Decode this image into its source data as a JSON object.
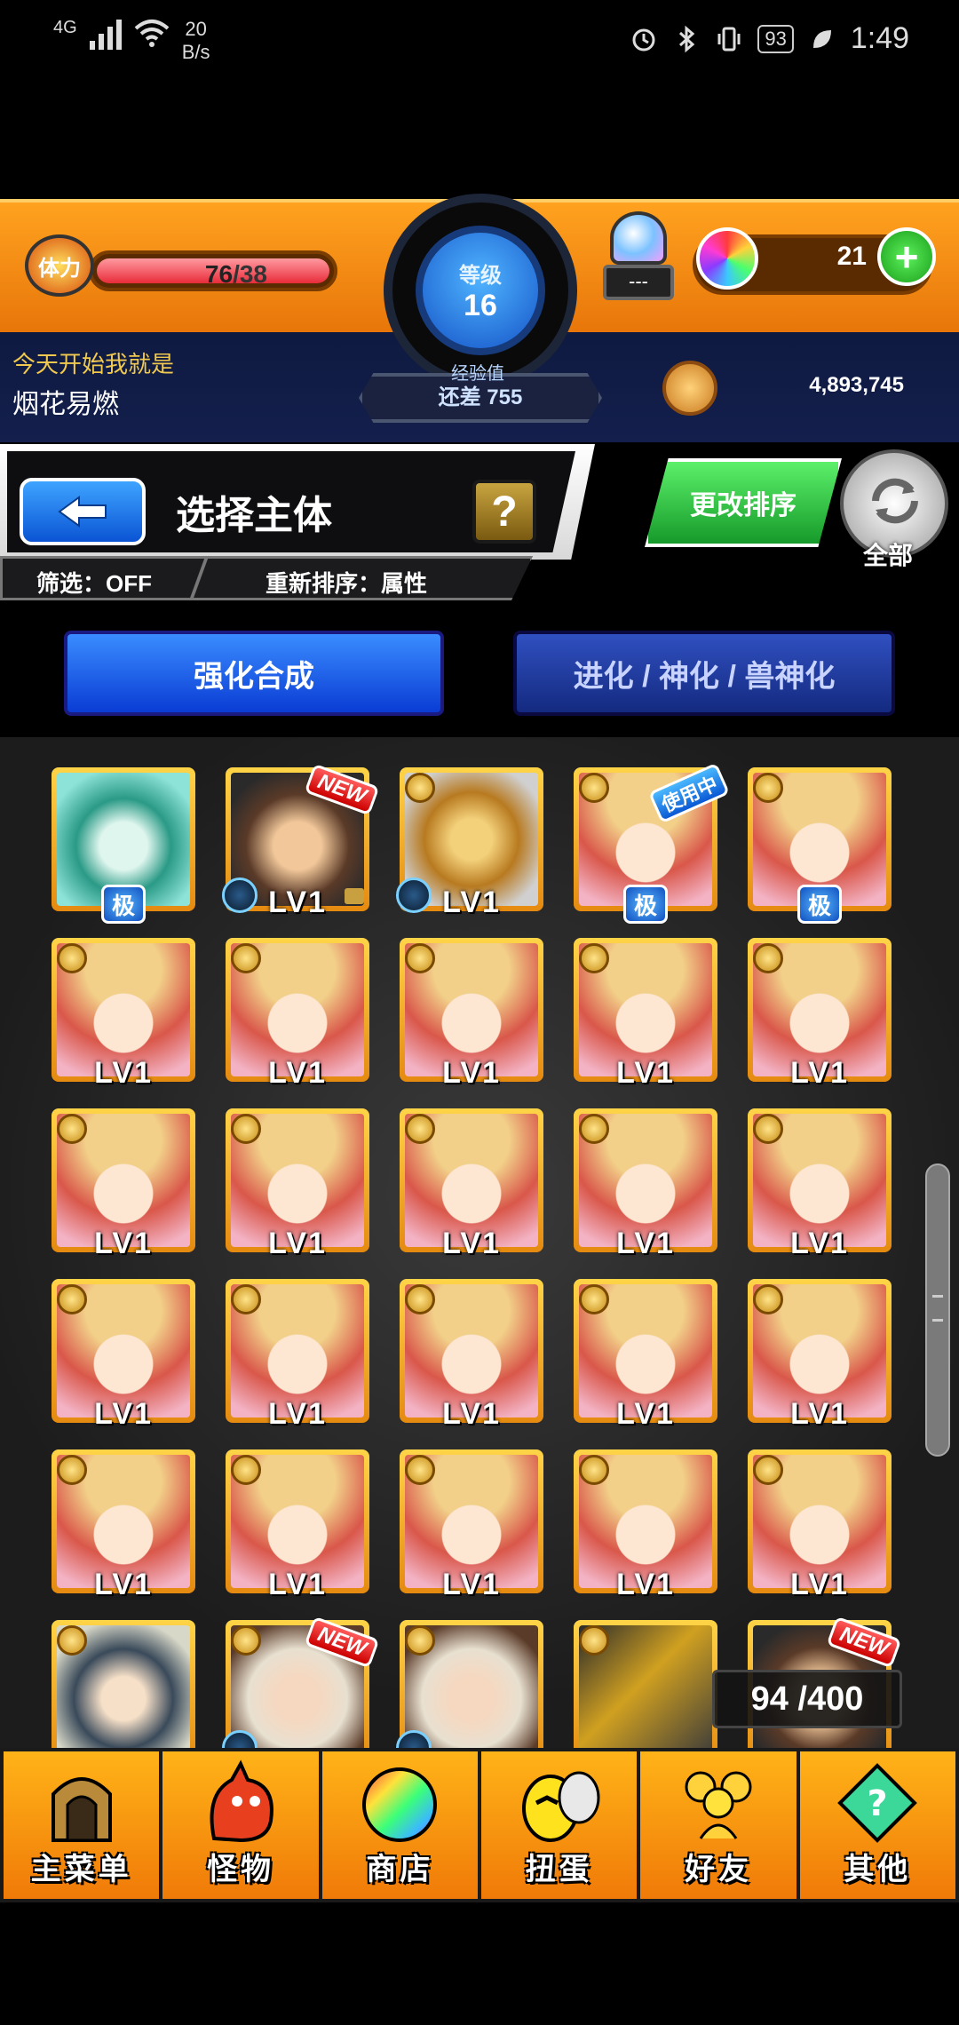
{
  "status_bar": {
    "network": "4G",
    "speed_value": "20",
    "speed_unit": "B/s",
    "battery": "93",
    "time": "1:49"
  },
  "hud": {
    "stamina_label": "体力",
    "stamina_current": "76",
    "stamina_max": "/38",
    "rank_label": "等级",
    "rank_value": "16",
    "exp_label": "经验值",
    "exp_remaining": "还差 755",
    "capsule_text": "---",
    "orb_count": "21",
    "motto_label": "今天开始我就是",
    "motto_value": "烟花易燃",
    "gold": "4,893,745"
  },
  "title": {
    "text": "选择主体",
    "help": "?",
    "filter": "筛选：OFF",
    "sort": "重新排序：属性",
    "sort_button": "更改排序",
    "all_label": "全部"
  },
  "modes": {
    "strengthen": "强化合成",
    "evolve": "进化 / 神化 / 兽神化"
  },
  "monsters": [
    {
      "art": "boy",
      "ultra": "极"
    },
    {
      "art": "brown",
      "level": "LV1",
      "badge": "NEW",
      "lock": true,
      "wood": true
    },
    {
      "art": "robot",
      "level": "LV1",
      "wood": true
    },
    {
      "art": "girl",
      "ultra": "极",
      "badge_inuse": "使用中"
    },
    {
      "art": "girl",
      "ultra": "极"
    },
    {
      "art": "girl",
      "level": "LV1"
    },
    {
      "art": "girl",
      "level": "LV1"
    },
    {
      "art": "girl",
      "level": "LV1"
    },
    {
      "art": "girl",
      "level": "LV1"
    },
    {
      "art": "girl",
      "level": "LV1"
    },
    {
      "art": "girl",
      "level": "LV1"
    },
    {
      "art": "girl",
      "level": "LV1"
    },
    {
      "art": "girl",
      "level": "LV1"
    },
    {
      "art": "girl",
      "level": "LV1"
    },
    {
      "art": "girl",
      "level": "LV1"
    },
    {
      "art": "girl",
      "level": "LV1"
    },
    {
      "art": "girl",
      "level": "LV1"
    },
    {
      "art": "girl",
      "level": "LV1"
    },
    {
      "art": "girl",
      "level": "LV1"
    },
    {
      "art": "girl",
      "level": "LV1"
    },
    {
      "art": "girl",
      "level": "LV1"
    },
    {
      "art": "girl",
      "level": "LV1"
    },
    {
      "art": "girl",
      "level": "LV1"
    },
    {
      "art": "girl",
      "level": "LV1"
    },
    {
      "art": "girl",
      "level": "LV1"
    },
    {
      "art": "samurai"
    },
    {
      "art": "fur",
      "badge": "NEW",
      "wood": true
    },
    {
      "art": "fur",
      "wood": true
    },
    {
      "art": "mech"
    },
    {
      "art": "brown",
      "badge": "NEW"
    }
  ],
  "box_count": "94 /400",
  "nav": [
    {
      "name": "main-menu",
      "label": "主菜单",
      "icon": "gate-icon"
    },
    {
      "name": "monsters",
      "label": "怪物",
      "icon": "dragon-icon"
    },
    {
      "name": "shop",
      "label": "商店",
      "icon": "orb-icon"
    },
    {
      "name": "gacha",
      "label": "扭蛋",
      "icon": "egg-icon"
    },
    {
      "name": "friends",
      "label": "好友",
      "icon": "friends-icon"
    },
    {
      "name": "other",
      "label": "其他",
      "icon": "other-icon"
    }
  ]
}
